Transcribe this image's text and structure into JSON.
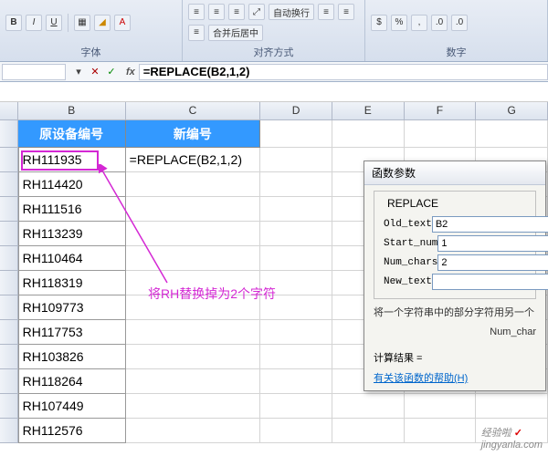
{
  "ribbon": {
    "group_font": "字体",
    "group_align": "对齐方式",
    "group_number": "数字",
    "wrap_text": "自动换行",
    "merge_center": "合并后居中"
  },
  "formula_bar": {
    "name_box": "",
    "formula": "=REPLACE(B2,1,2)"
  },
  "columns": {
    "B": "B",
    "C": "C",
    "D": "D",
    "E": "E",
    "F": "F",
    "G": "G"
  },
  "headers": {
    "B": "原设备编号",
    "C": "新编号"
  },
  "data": [
    {
      "id": "RH111935",
      "c": "=REPLACE(B2,1,2)"
    },
    {
      "id": "RH114420",
      "c": ""
    },
    {
      "id": "RH111516",
      "c": ""
    },
    {
      "id": "RH113239",
      "c": ""
    },
    {
      "id": "RH110464",
      "c": ""
    },
    {
      "id": "RH118319",
      "c": ""
    },
    {
      "id": "RH109773",
      "c": ""
    },
    {
      "id": "RH117753",
      "c": ""
    },
    {
      "id": "RH103826",
      "c": ""
    },
    {
      "id": "RH118264",
      "c": ""
    },
    {
      "id": "RH107449",
      "c": ""
    },
    {
      "id": "RH112576",
      "c": ""
    }
  ],
  "annotation": "将RH替换掉为2个字符",
  "dialog": {
    "title": "函数参数",
    "func_name": "REPLACE",
    "fields": {
      "old_text": {
        "label": "Old_text",
        "value": "B2"
      },
      "start_num": {
        "label": "Start_num",
        "value": "1"
      },
      "num_chars": {
        "label": "Num_chars",
        "value": "2"
      },
      "new_text": {
        "label": "New_text",
        "value": ""
      }
    },
    "desc_line1": "将一个字符串中的部分字符用另一个",
    "desc_line2": "Num_char",
    "result_label": "计算结果 =",
    "help_link": "有关该函数的帮助(H)"
  },
  "watermark": {
    "brand": "经验啦",
    "check": "✓",
    "url": "jingyanla.com"
  }
}
